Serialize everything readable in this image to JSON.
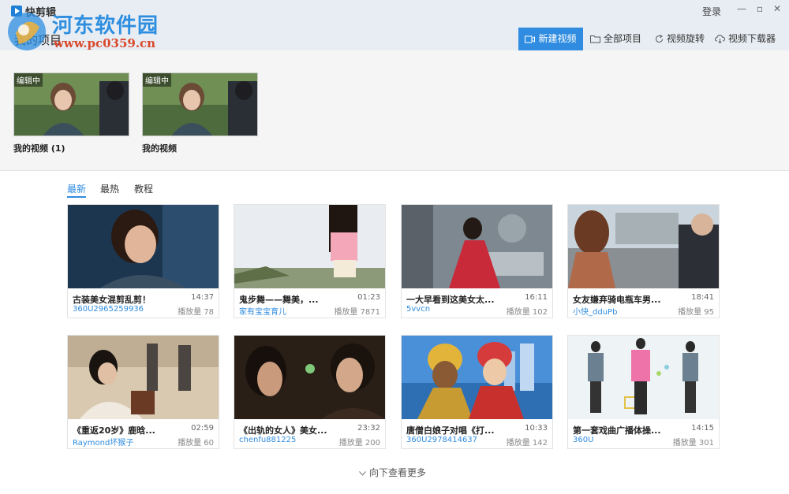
{
  "app": {
    "name": "快剪辑",
    "section_title": "我的项目",
    "login": "登录"
  },
  "watermark": {
    "name": "河东软件园",
    "url": "www.pc0359.cn"
  },
  "toolbar": {
    "new_video": "新建视频",
    "all_projects": "全部项目",
    "rotate": "视频旋转",
    "downloader": "视频下载器"
  },
  "projects": [
    {
      "tag": "编辑中",
      "name": "我的视频 (1)"
    },
    {
      "tag": "编辑中",
      "name": "我的视频"
    }
  ],
  "tabs": [
    "最新",
    "最热",
    "教程"
  ],
  "active_tab": "最新",
  "play_label": "播放量",
  "videos": [
    {
      "title": "古装美女混剪乱剪！",
      "duration": "14:37",
      "author": "360U2965259936",
      "plays": "播放量 78"
    },
    {
      "title": "鬼步舞——舞美，...",
      "duration": "01:23",
      "author": "家有宝宝育儿",
      "plays": "播放量 7871"
    },
    {
      "title": "一大早看到这美女太...",
      "duration": "16:11",
      "author": "5vvcn",
      "plays": "播放量 102"
    },
    {
      "title": "女友嫌弃骑电瓶车男...",
      "duration": "18:41",
      "author": "小快_dduPb",
      "plays": "播放量 95"
    },
    {
      "title": "《重返20岁》鹿晗...",
      "duration": "02:59",
      "author": "Raymond坏猴子",
      "plays": "播放量 60"
    },
    {
      "title": "《出轨的女人》美女...",
      "duration": "23:32",
      "author": "chenfu881225",
      "plays": "播放量 200"
    },
    {
      "title": "唐僧白娘子对唱《打...",
      "duration": "10:33",
      "author": "360U2978414637",
      "plays": "播放量 142"
    },
    {
      "title": "第一套戏曲广播体操...",
      "duration": "14:15",
      "author": "360U",
      "plays": "播放量 301"
    }
  ],
  "load_more": "向下查看更多",
  "colors": {
    "accent": "#2f8ce0",
    "header_bg": "#e8edf3",
    "projects_bg": "#f5f5f5"
  }
}
